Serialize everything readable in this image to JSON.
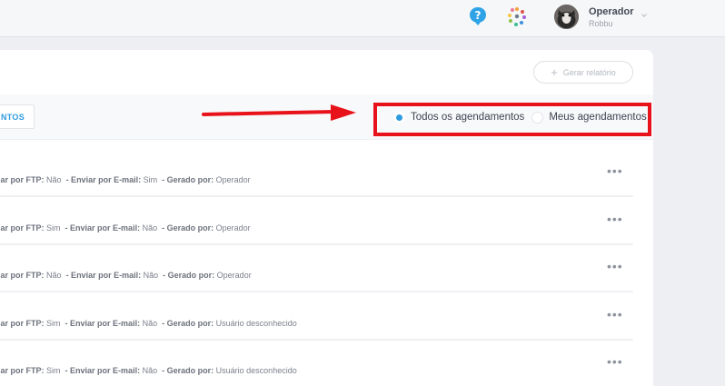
{
  "header": {
    "help_icon": "help-question-icon",
    "apps_icon": "apps-dots-icon",
    "user": {
      "name": "Operador",
      "org": "Robbu"
    }
  },
  "card": {
    "generate_report_label": "Gerar relatório",
    "tab_label": "NTOS",
    "filter": {
      "options": [
        {
          "label": "Todos os agendamentos",
          "checked": true
        },
        {
          "label": "Meus agendamentos",
          "checked": false
        }
      ]
    },
    "rows": [
      {
        "ftp_label": "iar por FTP:",
        "ftp": "Não",
        "email_label": "- Enviar por E-mail:",
        "email": "Sim",
        "by_label": "- Gerado por:",
        "by": "Operador"
      },
      {
        "ftp_label": "iar por FTP:",
        "ftp": "Sim",
        "email_label": "- Enviar por E-mail:",
        "email": "Não",
        "by_label": "- Gerado por:",
        "by": "Operador"
      },
      {
        "ftp_label": "iar por FTP:",
        "ftp": "Não",
        "email_label": "- Enviar por E-mail:",
        "email": "Não",
        "by_label": "- Gerado por:",
        "by": "Operador"
      },
      {
        "ftp_label": "iar por FTP:",
        "ftp": "Sim",
        "email_label": "- Enviar por E-mail:",
        "email": "Não",
        "by_label": "- Gerado por:",
        "by": "Usuário desconhecido"
      },
      {
        "ftp_label": "iar por FTP:",
        "ftp": "Sim",
        "email_label": "- Enviar por E-mail:",
        "email": "Não",
        "by_label": "- Gerado por:",
        "by": "Usuário desconhecido"
      }
    ],
    "row_menu_icon": "more-horizontal-icon"
  },
  "annotation": {
    "color": "#e8131a"
  },
  "colors": {
    "accent": "#2e9be0",
    "background": "#eeeff3"
  }
}
